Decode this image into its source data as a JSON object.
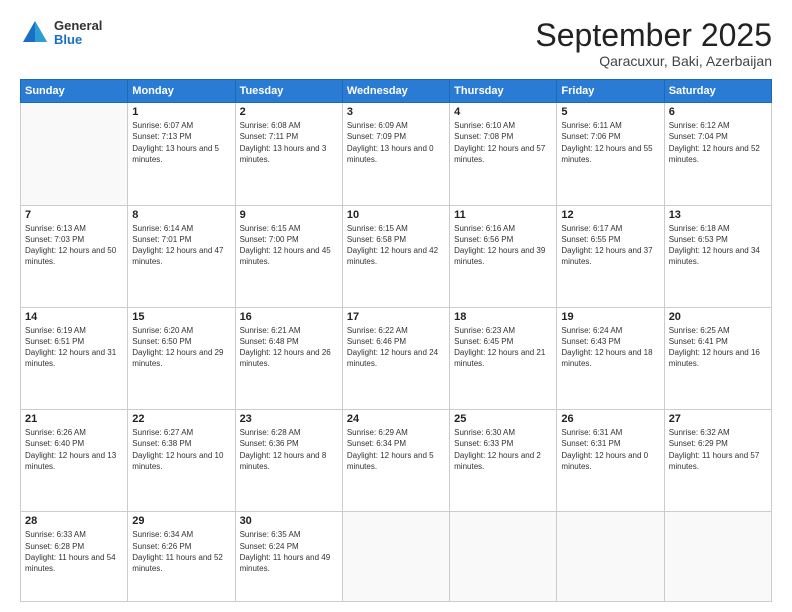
{
  "logo": {
    "general": "General",
    "blue": "Blue"
  },
  "title": "September 2025",
  "subtitle": "Qaracuxur, Baki, Azerbaijan",
  "days_header": [
    "Sunday",
    "Monday",
    "Tuesday",
    "Wednesday",
    "Thursday",
    "Friday",
    "Saturday"
  ],
  "weeks": [
    [
      {
        "day": "",
        "sunrise": "",
        "sunset": "",
        "daylight": ""
      },
      {
        "day": "1",
        "sunrise": "Sunrise: 6:07 AM",
        "sunset": "Sunset: 7:13 PM",
        "daylight": "Daylight: 13 hours and 5 minutes."
      },
      {
        "day": "2",
        "sunrise": "Sunrise: 6:08 AM",
        "sunset": "Sunset: 7:11 PM",
        "daylight": "Daylight: 13 hours and 3 minutes."
      },
      {
        "day": "3",
        "sunrise": "Sunrise: 6:09 AM",
        "sunset": "Sunset: 7:09 PM",
        "daylight": "Daylight: 13 hours and 0 minutes."
      },
      {
        "day": "4",
        "sunrise": "Sunrise: 6:10 AM",
        "sunset": "Sunset: 7:08 PM",
        "daylight": "Daylight: 12 hours and 57 minutes."
      },
      {
        "day": "5",
        "sunrise": "Sunrise: 6:11 AM",
        "sunset": "Sunset: 7:06 PM",
        "daylight": "Daylight: 12 hours and 55 minutes."
      },
      {
        "day": "6",
        "sunrise": "Sunrise: 6:12 AM",
        "sunset": "Sunset: 7:04 PM",
        "daylight": "Daylight: 12 hours and 52 minutes."
      }
    ],
    [
      {
        "day": "7",
        "sunrise": "Sunrise: 6:13 AM",
        "sunset": "Sunset: 7:03 PM",
        "daylight": "Daylight: 12 hours and 50 minutes."
      },
      {
        "day": "8",
        "sunrise": "Sunrise: 6:14 AM",
        "sunset": "Sunset: 7:01 PM",
        "daylight": "Daylight: 12 hours and 47 minutes."
      },
      {
        "day": "9",
        "sunrise": "Sunrise: 6:15 AM",
        "sunset": "Sunset: 7:00 PM",
        "daylight": "Daylight: 12 hours and 45 minutes."
      },
      {
        "day": "10",
        "sunrise": "Sunrise: 6:15 AM",
        "sunset": "Sunset: 6:58 PM",
        "daylight": "Daylight: 12 hours and 42 minutes."
      },
      {
        "day": "11",
        "sunrise": "Sunrise: 6:16 AM",
        "sunset": "Sunset: 6:56 PM",
        "daylight": "Daylight: 12 hours and 39 minutes."
      },
      {
        "day": "12",
        "sunrise": "Sunrise: 6:17 AM",
        "sunset": "Sunset: 6:55 PM",
        "daylight": "Daylight: 12 hours and 37 minutes."
      },
      {
        "day": "13",
        "sunrise": "Sunrise: 6:18 AM",
        "sunset": "Sunset: 6:53 PM",
        "daylight": "Daylight: 12 hours and 34 minutes."
      }
    ],
    [
      {
        "day": "14",
        "sunrise": "Sunrise: 6:19 AM",
        "sunset": "Sunset: 6:51 PM",
        "daylight": "Daylight: 12 hours and 31 minutes."
      },
      {
        "day": "15",
        "sunrise": "Sunrise: 6:20 AM",
        "sunset": "Sunset: 6:50 PM",
        "daylight": "Daylight: 12 hours and 29 minutes."
      },
      {
        "day": "16",
        "sunrise": "Sunrise: 6:21 AM",
        "sunset": "Sunset: 6:48 PM",
        "daylight": "Daylight: 12 hours and 26 minutes."
      },
      {
        "day": "17",
        "sunrise": "Sunrise: 6:22 AM",
        "sunset": "Sunset: 6:46 PM",
        "daylight": "Daylight: 12 hours and 24 minutes."
      },
      {
        "day": "18",
        "sunrise": "Sunrise: 6:23 AM",
        "sunset": "Sunset: 6:45 PM",
        "daylight": "Daylight: 12 hours and 21 minutes."
      },
      {
        "day": "19",
        "sunrise": "Sunrise: 6:24 AM",
        "sunset": "Sunset: 6:43 PM",
        "daylight": "Daylight: 12 hours and 18 minutes."
      },
      {
        "day": "20",
        "sunrise": "Sunrise: 6:25 AM",
        "sunset": "Sunset: 6:41 PM",
        "daylight": "Daylight: 12 hours and 16 minutes."
      }
    ],
    [
      {
        "day": "21",
        "sunrise": "Sunrise: 6:26 AM",
        "sunset": "Sunset: 6:40 PM",
        "daylight": "Daylight: 12 hours and 13 minutes."
      },
      {
        "day": "22",
        "sunrise": "Sunrise: 6:27 AM",
        "sunset": "Sunset: 6:38 PM",
        "daylight": "Daylight: 12 hours and 10 minutes."
      },
      {
        "day": "23",
        "sunrise": "Sunrise: 6:28 AM",
        "sunset": "Sunset: 6:36 PM",
        "daylight": "Daylight: 12 hours and 8 minutes."
      },
      {
        "day": "24",
        "sunrise": "Sunrise: 6:29 AM",
        "sunset": "Sunset: 6:34 PM",
        "daylight": "Daylight: 12 hours and 5 minutes."
      },
      {
        "day": "25",
        "sunrise": "Sunrise: 6:30 AM",
        "sunset": "Sunset: 6:33 PM",
        "daylight": "Daylight: 12 hours and 2 minutes."
      },
      {
        "day": "26",
        "sunrise": "Sunrise: 6:31 AM",
        "sunset": "Sunset: 6:31 PM",
        "daylight": "Daylight: 12 hours and 0 minutes."
      },
      {
        "day": "27",
        "sunrise": "Sunrise: 6:32 AM",
        "sunset": "Sunset: 6:29 PM",
        "daylight": "Daylight: 11 hours and 57 minutes."
      }
    ],
    [
      {
        "day": "28",
        "sunrise": "Sunrise: 6:33 AM",
        "sunset": "Sunset: 6:28 PM",
        "daylight": "Daylight: 11 hours and 54 minutes."
      },
      {
        "day": "29",
        "sunrise": "Sunrise: 6:34 AM",
        "sunset": "Sunset: 6:26 PM",
        "daylight": "Daylight: 11 hours and 52 minutes."
      },
      {
        "day": "30",
        "sunrise": "Sunrise: 6:35 AM",
        "sunset": "Sunset: 6:24 PM",
        "daylight": "Daylight: 11 hours and 49 minutes."
      },
      {
        "day": "",
        "sunrise": "",
        "sunset": "",
        "daylight": ""
      },
      {
        "day": "",
        "sunrise": "",
        "sunset": "",
        "daylight": ""
      },
      {
        "day": "",
        "sunrise": "",
        "sunset": "",
        "daylight": ""
      },
      {
        "day": "",
        "sunrise": "",
        "sunset": "",
        "daylight": ""
      }
    ]
  ]
}
